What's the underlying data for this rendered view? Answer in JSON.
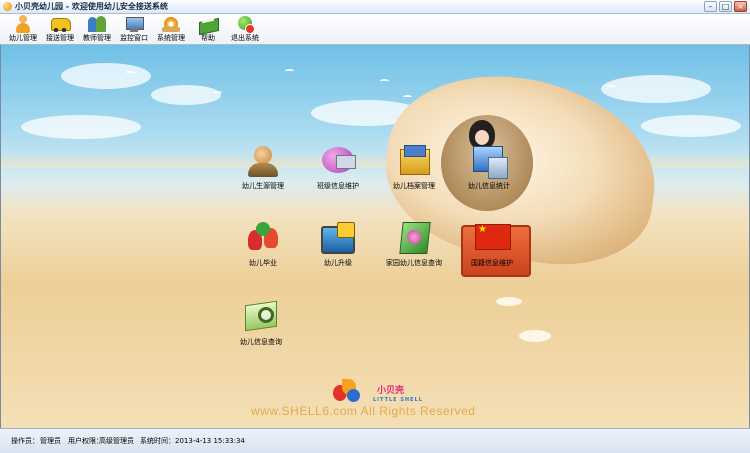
{
  "window": {
    "title": "小贝壳幼儿园 - 欢迎使用幼儿安全接送系统",
    "minimize": "–",
    "maximize": "□",
    "close": "×"
  },
  "toolbar": {
    "items": [
      {
        "label": "幼儿管理",
        "icon": "child-icon"
      },
      {
        "label": "接送管理",
        "icon": "bus-icon"
      },
      {
        "label": "教师管理",
        "icon": "staff-icon"
      },
      {
        "label": "监控窗口",
        "icon": "monitor-icon"
      },
      {
        "label": "系统管理",
        "icon": "gear-icon"
      },
      {
        "label": "帮助",
        "icon": "book-icon"
      },
      {
        "label": "退出系统",
        "icon": "exit-icon"
      }
    ]
  },
  "desktop": {
    "icons": [
      {
        "label": "幼儿生源管理",
        "icon": "child-avatar-icon"
      },
      {
        "label": "班级信息维护",
        "icon": "classroom-icon"
      },
      {
        "label": "幼儿档案管理",
        "icon": "file-icon"
      },
      {
        "label": "幼儿信息统计",
        "icon": "statistics-icon"
      },
      {
        "label": "幼儿毕业",
        "icon": "graduation-icon"
      },
      {
        "label": "幼儿升级",
        "icon": "upgrade-icon"
      },
      {
        "label": "家园幼儿信息查询",
        "icon": "family-icon"
      },
      {
        "label": "国籍信息维护",
        "icon": "flag-icon"
      },
      {
        "label": "幼儿信息查询",
        "icon": "search-icon"
      }
    ],
    "logo_cn": "小贝壳",
    "logo_en": "LITTLE SHELL",
    "copyright": "www.SHELL6.com    All Rights Reserved"
  },
  "status": {
    "operator_label": "操作员：",
    "operator_value": "管理员",
    "permission_label": "用户权限：",
    "permission_value": "高级管理员",
    "time_label": "系统时间：",
    "time_value": "2013-4-13 15:33:34"
  }
}
